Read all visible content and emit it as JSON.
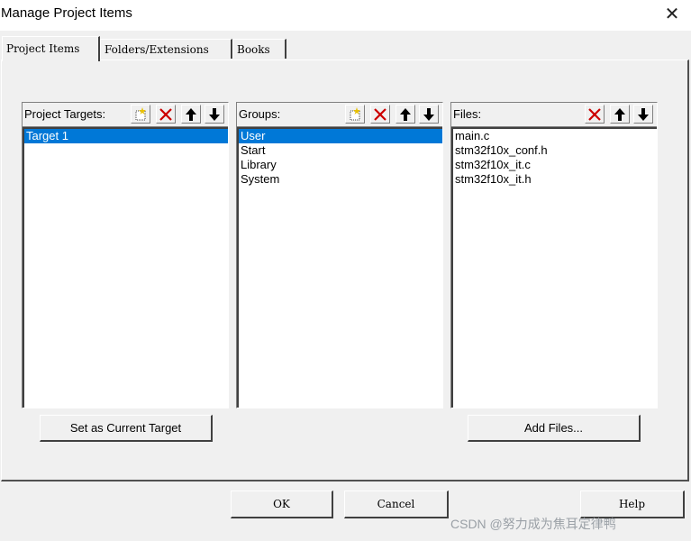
{
  "window": {
    "title": "Manage Project Items",
    "close_icon": "close-icon"
  },
  "tabs": [
    {
      "label": "Project Items",
      "active": true
    },
    {
      "label": "Folders/Extensions",
      "active": false
    },
    {
      "label": "Books",
      "active": false
    }
  ],
  "targets": {
    "label": "Project Targets:",
    "items": [
      "Target 1"
    ],
    "selected": 0,
    "button": "Set as Current Target"
  },
  "groups": {
    "label": "Groups:",
    "items": [
      "User",
      "Start",
      "Library",
      "System"
    ],
    "selected": 0
  },
  "files": {
    "label": "Files:",
    "items": [
      "main.c",
      "stm32f10x_conf.h",
      "stm32f10x_it.c",
      "stm32f10x_it.h"
    ],
    "button": "Add Files..."
  },
  "footer": {
    "ok": "OK",
    "cancel": "Cancel",
    "help": "Help"
  },
  "watermark": "CSDN @努力成为焦耳定律鸭",
  "colors": {
    "selection": "#0078d7",
    "delete_x": "#cc0000"
  }
}
